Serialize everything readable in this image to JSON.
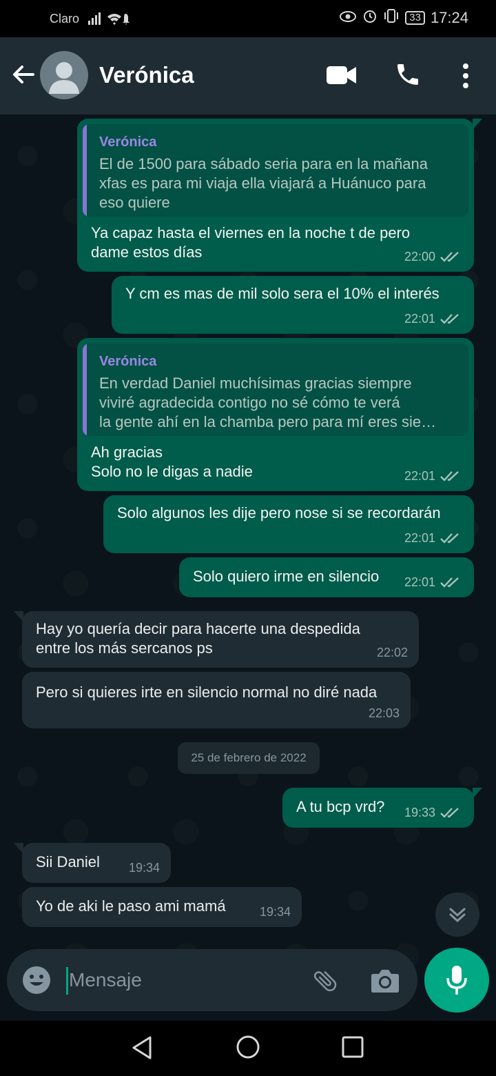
{
  "status_bar": {
    "carrier": "Claro",
    "battery": "33",
    "time": "17:24"
  },
  "header": {
    "contact_name": "Verónica"
  },
  "messages": [
    {
      "direction": "out",
      "quote": {
        "author": "Verónica",
        "text": "El de 1500 para sábado seria  para en la mañana\nxfas es para mi viaja ella viajará a Huánuco para\neso quiere"
      },
      "text": "Ya capaz hasta el viernes en la noche t de pero\ndame estos días",
      "time": "22:00"
    },
    {
      "direction": "out",
      "text": "Y cm es mas de  mil solo sera el 10% el interés",
      "time": "22:01"
    },
    {
      "direction": "out",
      "quote": {
        "author": "Verónica",
        "text": "En verdad Daniel muchísimas gracias siempre\nviviré agradecida contigo no sé cómo te verá\nla gente ahí en la chamba pero para mí eres sie…"
      },
      "text": "Ah gracias\nSolo no le digas a nadie",
      "time": "22:01"
    },
    {
      "direction": "out",
      "text": "Solo algunos les dije pero nose si se recordarán",
      "time": "22:01"
    },
    {
      "direction": "out",
      "text": "Solo quiero irme en silencio",
      "time": "22:01"
    },
    {
      "direction": "in",
      "text": "Hay  yo quería decir para hacerte una despedida\nentre los más sercanos ps",
      "time": "22:02"
    },
    {
      "direction": "in",
      "text": "Pero si quieres irte en silencio normal no diré nada",
      "time": "22:03"
    },
    {
      "direction": "out",
      "text": "A tu bcp vrd?",
      "time": "19:33"
    },
    {
      "direction": "in",
      "text": "Sii  Daniel",
      "time": "19:34"
    },
    {
      "direction": "in",
      "text": "Yo de aki le paso ami mamá",
      "time": "19:34"
    }
  ],
  "date_separator": "25 de febrero de 2022",
  "input": {
    "placeholder": "Mensaje"
  },
  "icons": [
    "back-arrow-icon",
    "video-call-icon",
    "phone-icon",
    "more-vert-icon",
    "emoji-icon",
    "attach-icon",
    "camera-icon",
    "mic-icon",
    "double-check-icon",
    "chevron-double-down-icon"
  ],
  "colors": {
    "outgoing_bubble": "#005c4b",
    "incoming_bubble": "#202c33",
    "accent": "#00a884",
    "header": "#1f2c34",
    "background": "#0b141a"
  }
}
